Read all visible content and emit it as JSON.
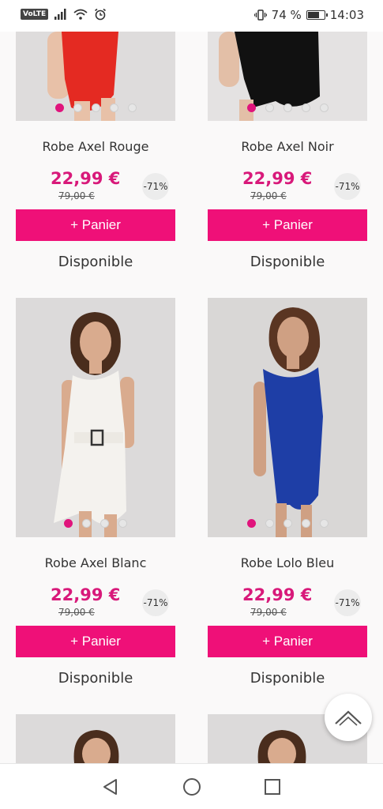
{
  "status_bar": {
    "volte": "VoLTE",
    "battery_percent": "74 %",
    "battery_level": 0.74,
    "time": "14:03"
  },
  "products": [
    {
      "name": "Robe Axel Rouge",
      "price": "22,99 €",
      "old_price": "79,00 €",
      "discount": "-71%",
      "cart_label": "+ Panier",
      "availability": "Disponible",
      "dress_color": "#e42a22",
      "active_dot": 1,
      "dot_count": 5
    },
    {
      "name": "Robe Axel Noir",
      "price": "22,99 €",
      "old_price": "79,00 €",
      "discount": "-71%",
      "cart_label": "+ Panier",
      "availability": "Disponible",
      "dress_color": "#111111",
      "active_dot": 1,
      "dot_count": 5
    },
    {
      "name": "Robe Axel Blanc",
      "price": "22,99 €",
      "old_price": "79,00 €",
      "discount": "-71%",
      "cart_label": "+ Panier",
      "availability": "Disponible",
      "dress_color": "#f4f2ee",
      "active_dot": 1,
      "dot_count": 4
    },
    {
      "name": "Robe Lolo Bleu",
      "price": "22,99 €",
      "old_price": "79,00 €",
      "discount": "-71%",
      "cart_label": "+ Panier",
      "availability": "Disponible",
      "dress_color": "#1e3ea6",
      "active_dot": 1,
      "dot_count": 5
    }
  ],
  "colors": {
    "accent": "#ef1078",
    "price": "#d8197a"
  },
  "icons": {
    "scroll_top": "chevron-up-icon",
    "nav_back": "triangle-back-icon",
    "nav_home": "circle-home-icon",
    "nav_recent": "square-recents-icon"
  }
}
